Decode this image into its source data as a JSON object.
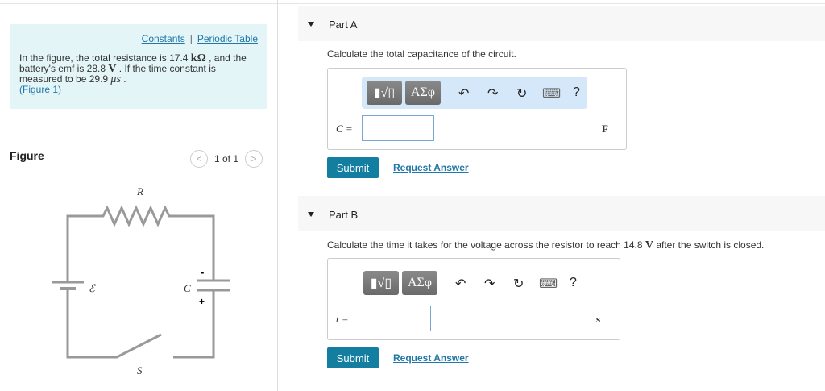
{
  "problem": {
    "links": {
      "constants": "Constants",
      "separator": "|",
      "periodic_table": "Periodic Table"
    },
    "text_1": "In the figure, the total resistance is 17.4 ",
    "unit_r": "kΩ",
    "text_2": " , and the battery's emf is 28.8 ",
    "unit_v": "V",
    "text_3": " . If the time constant is measured to be 29.9 ",
    "unit_t": "μs",
    "text_4": " .",
    "figure_link": "(Figure 1)"
  },
  "figure": {
    "title": "Figure",
    "pager": "1 of 1",
    "labels": {
      "r": "R",
      "emf": "ℰ",
      "c": "C",
      "s": "S",
      "minus": "-",
      "plus": "+"
    }
  },
  "parts": [
    {
      "title": "Part A",
      "question": "Calculate the total capacitance of the circuit.",
      "var": "C =",
      "value": "",
      "unit": "F",
      "submit": "Submit",
      "request": "Request Answer"
    },
    {
      "title": "Part B",
      "question_1": "Calculate the time it takes for the voltage across the resistor to reach 14.8 ",
      "question_unit": "V",
      "question_2": " after the switch is closed.",
      "var": "t =",
      "value": "",
      "unit": "s",
      "submit": "Submit",
      "request": "Request Answer"
    }
  ],
  "toolbar": {
    "templates": "▮√▯",
    "greek": "ΑΣφ",
    "undo": "↶",
    "redo": "↷",
    "reset": "↻",
    "keyboard": "⌨",
    "help": "?"
  }
}
